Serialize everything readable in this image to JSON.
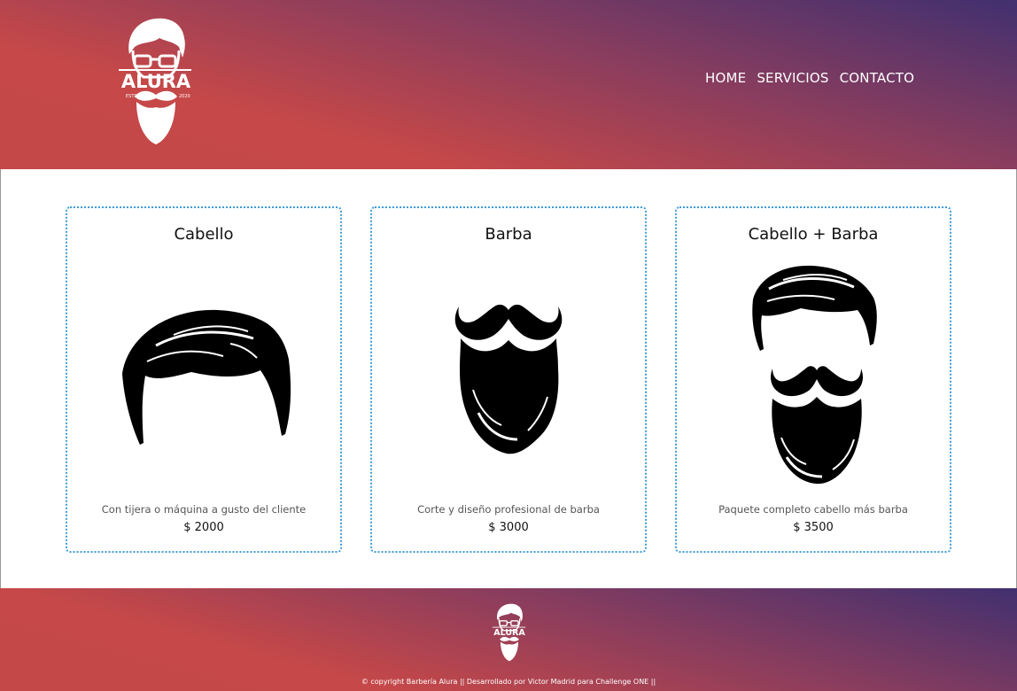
{
  "header": {
    "logo": {
      "brand": "ALURA",
      "estd_left": "ESTD",
      "estd_right": "2020",
      "icon": "barber-man-logo-icon"
    },
    "nav": [
      {
        "label": "HOME"
      },
      {
        "label": "SERVICIOS"
      },
      {
        "label": "CONTACTO"
      }
    ]
  },
  "cards": [
    {
      "title": "Cabello",
      "icon": "hair-icon",
      "description": "Con tijera o máquina a gusto del cliente",
      "price": "$ 2000"
    },
    {
      "title": "Barba",
      "icon": "beard-icon",
      "description": "Corte y diseño profesional de barba",
      "price": "$ 3000"
    },
    {
      "title": "Cabello + Barba",
      "icon": "hair-and-beard-icon",
      "description": "Paquete completo cabello más barba",
      "price": "$ 3500"
    }
  ],
  "footer": {
    "logo_icon": "barber-man-logo-icon",
    "text": "© copyright Barbería Alura || Desarrollado por Victor Madrid para Challenge ONE ||"
  },
  "colors": {
    "gradient_red": "#c64848",
    "gradient_purple": "#41306f",
    "card_border": "#3d9bd6"
  }
}
